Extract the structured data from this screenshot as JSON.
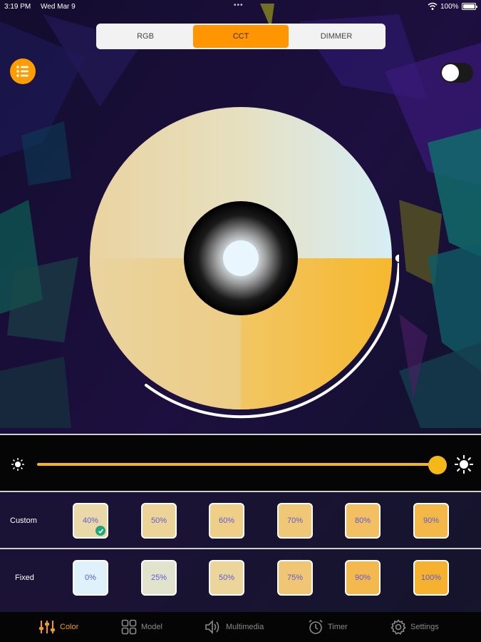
{
  "status_bar": {
    "time": "3:19 PM",
    "date": "Wed Mar 9",
    "dots": "•••",
    "battery": "100%"
  },
  "segmented": {
    "items": [
      "RGB",
      "CCT",
      "DIMMER"
    ],
    "selected": "CCT"
  },
  "power_toggle": {
    "on": false
  },
  "cct_wheel": {
    "value_fraction": 0.5
  },
  "brightness": {
    "value_percent": 100
  },
  "presets": {
    "custom": {
      "label": "Custom",
      "items": [
        {
          "label": "40%",
          "color": "#ead9a8",
          "selected": true
        },
        {
          "label": "50%",
          "color": "#ecd498"
        },
        {
          "label": "60%",
          "color": "#efcf88"
        },
        {
          "label": "70%",
          "color": "#f0c776"
        },
        {
          "label": "80%",
          "color": "#f2c062"
        },
        {
          "label": "90%",
          "color": "#f4b848"
        }
      ]
    },
    "fixed": {
      "label": "Fixed",
      "items": [
        {
          "label": "0%",
          "color": "#dff2fb"
        },
        {
          "label": "25%",
          "color": "#e2e3cc"
        },
        {
          "label": "50%",
          "color": "#ecd59a"
        },
        {
          "label": "75%",
          "color": "#f0c574"
        },
        {
          "label": "90%",
          "color": "#f3b84e"
        },
        {
          "label": "100%",
          "color": "#f6b12e"
        }
      ]
    }
  },
  "tabbar": {
    "items": [
      {
        "label": "Color",
        "icon": "sliders-icon",
        "active": true
      },
      {
        "label": "Model",
        "icon": "grid-icon",
        "active": false
      },
      {
        "label": "Multimedia",
        "icon": "speaker-icon",
        "active": false
      },
      {
        "label": "Timer",
        "icon": "alarm-clock-icon",
        "active": false
      },
      {
        "label": "Settings",
        "icon": "gear-icon",
        "active": false
      }
    ]
  },
  "colors": {
    "accent": "#ff9500",
    "slider": "#f5b917",
    "warm": "#f6b12e",
    "cool": "#dff2fb"
  }
}
